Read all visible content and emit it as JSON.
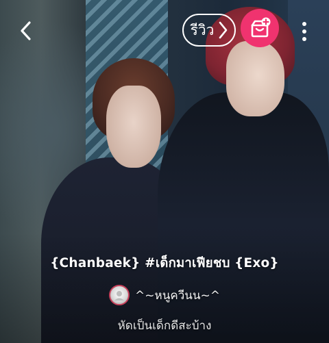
{
  "header": {
    "review_label": "รีวิว",
    "accent_color": "#f0336f"
  },
  "icons": {
    "back": "chevron-left-icon",
    "review_arrow": "chevron-right-icon",
    "library": "add-to-library-icon",
    "more": "more-vertical-icon"
  },
  "story": {
    "title": "{Chanbaek} #เด็กมาเฟียชบ {Exo}",
    "author": "^~หนูควีนน~^",
    "tagline": "หัดเป็นเด็กดีสะบ้าง"
  }
}
